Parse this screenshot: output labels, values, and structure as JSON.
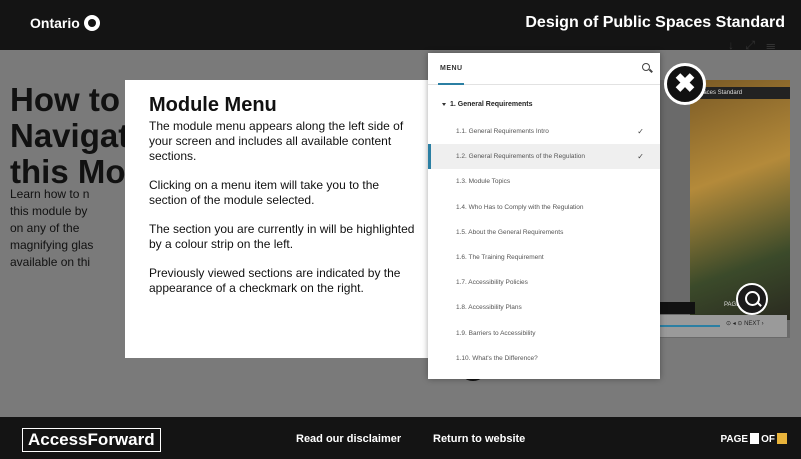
{
  "header": {
    "brand": "Ontario",
    "title": "Design of Public Spaces Standard"
  },
  "background": {
    "heading_lines": [
      "How to",
      "Navigat",
      "this Mo"
    ],
    "body_lines": [
      "Learn how to n",
      "this module by",
      "on any of the",
      "magnifying glas",
      "available on thi"
    ],
    "top_icons": "↓ ⤢ ☰",
    "photo_label": "Spaces Standard",
    "page_mini": "PAGE",
    "controls_text": "⊙ ◂ ⊙ NEXT ›"
  },
  "tooltip": {
    "title": "Module Menu",
    "paragraphs": [
      "The module menu appears along the left side of your screen and includes all available content sections.",
      "Clicking on a menu item will take you to the section of the module selected.",
      "The section you are currently in will be highlighted by a colour strip on the left.",
      "Previously viewed sections are indicated by the appearance of a checkmark on the right."
    ]
  },
  "menu": {
    "header_label": "MENU",
    "section": "1. General Requirements",
    "items": [
      {
        "label": "1.1. General Requirements Intro",
        "checked": true,
        "active": false
      },
      {
        "label": "1.2. General Requirements of the Regulation",
        "checked": true,
        "active": true
      },
      {
        "label": "1.3. Module Topics",
        "checked": false,
        "active": false
      },
      {
        "label": "1.4. Who Has to Comply with the Regulation",
        "checked": false,
        "active": false
      },
      {
        "label": "1.5. About the General Requirements",
        "checked": false,
        "active": false
      },
      {
        "label": "1.6. The Training Requirement",
        "checked": false,
        "active": false
      },
      {
        "label": "1.7. Accessibility Policies",
        "checked": false,
        "active": false
      },
      {
        "label": "1.8. Accessibility Plans",
        "checked": false,
        "active": false
      },
      {
        "label": "1.9. Barriers to Accessibility",
        "checked": false,
        "active": false
      },
      {
        "label": "1.10. What's the Difference?",
        "checked": false,
        "active": false
      }
    ],
    "check_glyph": "✓"
  },
  "close_glyph": "✖",
  "footer": {
    "brand": "AccessForward",
    "disclaimer_label": "Read our disclaimer",
    "return_label": "Return to website",
    "page_label": "PAGE",
    "of_label": "OF"
  },
  "colors": {
    "accent": "#2b7fa3",
    "highlight": "#e8b33b"
  }
}
